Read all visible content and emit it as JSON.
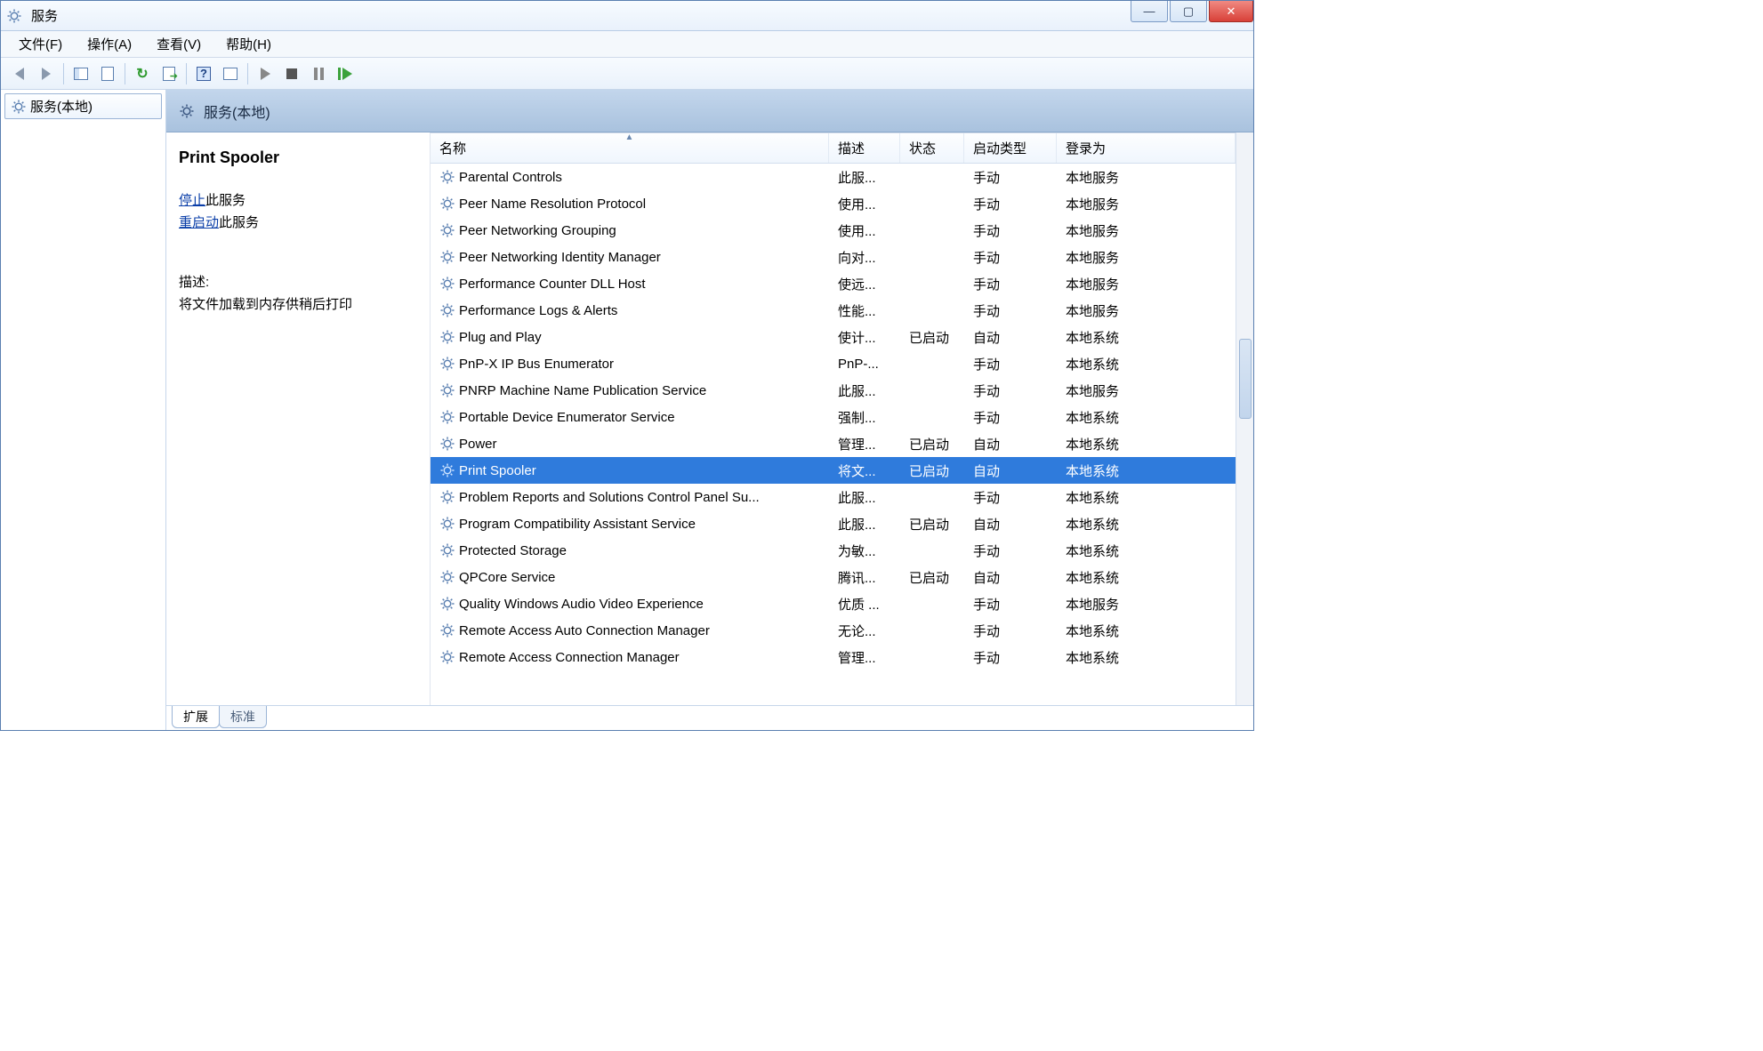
{
  "window": {
    "title": "服务"
  },
  "menu": {
    "file": "文件(F)",
    "action": "操作(A)",
    "view": "查看(V)",
    "help": "帮助(H)"
  },
  "tree": {
    "root": "服务(本地)"
  },
  "pane": {
    "title": "服务(本地)"
  },
  "detail": {
    "service_name": "Print Spooler",
    "stop_link": "停止",
    "stop_suffix": "此服务",
    "restart_link": "重启动",
    "restart_suffix": "此服务",
    "desc_label": "描述:",
    "desc_text": "将文件加载到内存供稍后打印"
  },
  "columns": {
    "name": "名称",
    "desc": "描述",
    "status": "状态",
    "startup": "启动类型",
    "logon": "登录为"
  },
  "tabs": {
    "extended": "扩展",
    "standard": "标准"
  },
  "services": [
    {
      "name": "Parental Controls",
      "desc": "此服...",
      "status": "",
      "startup": "手动",
      "logon": "本地服务",
      "selected": false
    },
    {
      "name": "Peer Name Resolution Protocol",
      "desc": "使用...",
      "status": "",
      "startup": "手动",
      "logon": "本地服务",
      "selected": false
    },
    {
      "name": "Peer Networking Grouping",
      "desc": "使用...",
      "status": "",
      "startup": "手动",
      "logon": "本地服务",
      "selected": false
    },
    {
      "name": "Peer Networking Identity Manager",
      "desc": "向对...",
      "status": "",
      "startup": "手动",
      "logon": "本地服务",
      "selected": false
    },
    {
      "name": "Performance Counter DLL Host",
      "desc": "使远...",
      "status": "",
      "startup": "手动",
      "logon": "本地服务",
      "selected": false
    },
    {
      "name": "Performance Logs & Alerts",
      "desc": "性能...",
      "status": "",
      "startup": "手动",
      "logon": "本地服务",
      "selected": false
    },
    {
      "name": "Plug and Play",
      "desc": "使计...",
      "status": "已启动",
      "startup": "自动",
      "logon": "本地系统",
      "selected": false
    },
    {
      "name": "PnP-X IP Bus Enumerator",
      "desc": "PnP-...",
      "status": "",
      "startup": "手动",
      "logon": "本地系统",
      "selected": false
    },
    {
      "name": "PNRP Machine Name Publication Service",
      "desc": "此服...",
      "status": "",
      "startup": "手动",
      "logon": "本地服务",
      "selected": false
    },
    {
      "name": "Portable Device Enumerator Service",
      "desc": "强制...",
      "status": "",
      "startup": "手动",
      "logon": "本地系统",
      "selected": false
    },
    {
      "name": "Power",
      "desc": "管理...",
      "status": "已启动",
      "startup": "自动",
      "logon": "本地系统",
      "selected": false
    },
    {
      "name": "Print Spooler",
      "desc": "将文...",
      "status": "已启动",
      "startup": "自动",
      "logon": "本地系统",
      "selected": true
    },
    {
      "name": "Problem Reports and Solutions Control Panel Su...",
      "desc": "此服...",
      "status": "",
      "startup": "手动",
      "logon": "本地系统",
      "selected": false
    },
    {
      "name": "Program Compatibility Assistant Service",
      "desc": "此服...",
      "status": "已启动",
      "startup": "自动",
      "logon": "本地系统",
      "selected": false
    },
    {
      "name": "Protected Storage",
      "desc": "为敏...",
      "status": "",
      "startup": "手动",
      "logon": "本地系统",
      "selected": false
    },
    {
      "name": "QPCore Service",
      "desc": "腾讯...",
      "status": "已启动",
      "startup": "自动",
      "logon": "本地系统",
      "selected": false
    },
    {
      "name": "Quality Windows Audio Video Experience",
      "desc": "优质 ...",
      "status": "",
      "startup": "手动",
      "logon": "本地服务",
      "selected": false
    },
    {
      "name": "Remote Access Auto Connection Manager",
      "desc": "无论...",
      "status": "",
      "startup": "手动",
      "logon": "本地系统",
      "selected": false
    },
    {
      "name": "Remote Access Connection Manager",
      "desc": "管理...",
      "status": "",
      "startup": "手动",
      "logon": "本地系统",
      "selected": false
    }
  ]
}
